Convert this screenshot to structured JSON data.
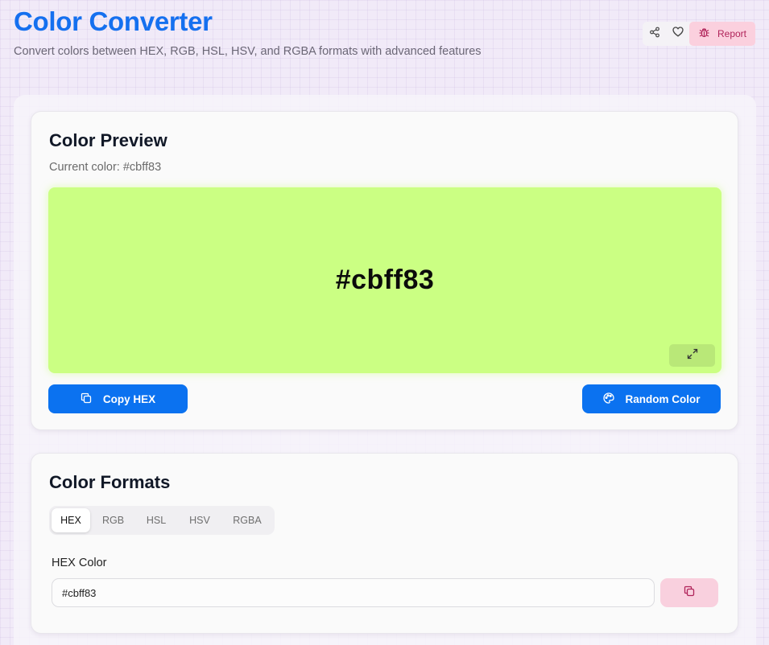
{
  "header": {
    "title": "Color Converter",
    "subtitle": "Convert colors between HEX, RGB, HSL, HSV, and RGBA formats with advanced features",
    "actions": {
      "share_icon": "share-icon",
      "favorite_icon": "heart-icon",
      "report_icon": "bug-icon",
      "report_label": "Report"
    }
  },
  "preview": {
    "title": "Color Preview",
    "current_label": "Current color: #cbff83",
    "color": "#cbff83",
    "swatch_text": "#cbff83",
    "expand_icon": "expand-icon",
    "copy_button": {
      "label": "Copy HEX",
      "icon": "copy-icon"
    },
    "random_button": {
      "label": "Random Color",
      "icon": "palette-icon"
    }
  },
  "formats": {
    "title": "Color Formats",
    "tabs": [
      {
        "label": "HEX",
        "active": true
      },
      {
        "label": "RGB",
        "active": false
      },
      {
        "label": "HSL",
        "active": false
      },
      {
        "label": "HSV",
        "active": false
      },
      {
        "label": "RGBA",
        "active": false
      }
    ],
    "field_label": "HEX Color",
    "field_value": "#cbff83",
    "copy_icon": "copy-icon"
  },
  "colors": {
    "brand": "#1570ef",
    "primary_button": "#0b72f0",
    "report_bg": "#fbd0de",
    "report_text": "#b0245a",
    "copy_field_bg": "#f9d0de"
  }
}
